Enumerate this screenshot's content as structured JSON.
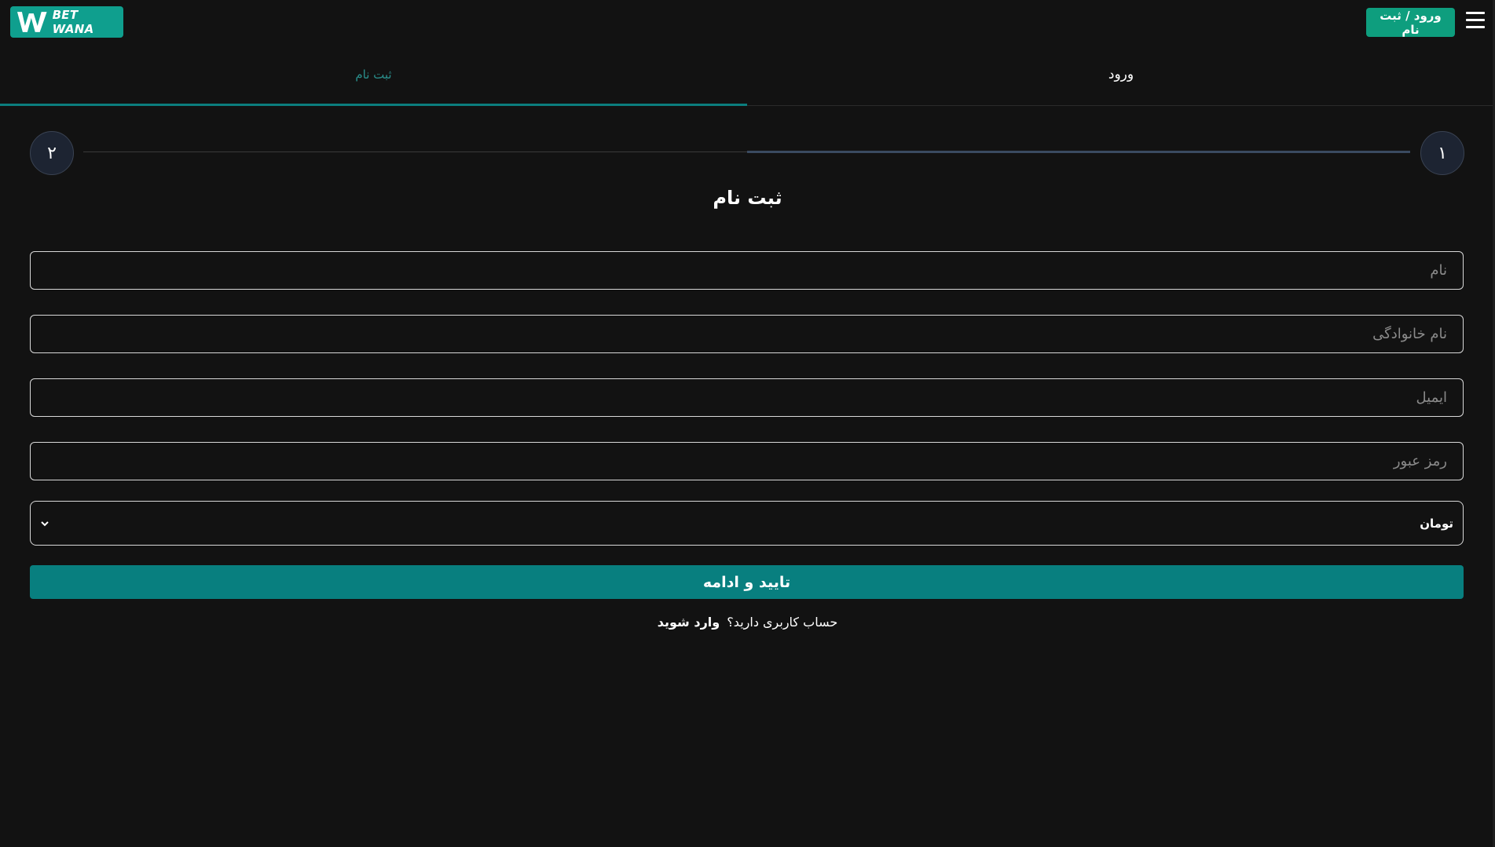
{
  "header": {
    "brand": "BET WANA",
    "auth_button": "ورود / ثبت نام",
    "menu_icon": "hamburger-icon"
  },
  "tabs": [
    {
      "label": "ثبت نام",
      "active": true
    },
    {
      "label": "ورود",
      "active": false
    }
  ],
  "stepper": {
    "step1": "۱",
    "step2": "۲",
    "current": 1
  },
  "form": {
    "title": "ثبت نام",
    "first_name_placeholder": "نام",
    "last_name_placeholder": "نام خانوادگی",
    "email_placeholder": "ایمیل",
    "password_placeholder": "رمز عبور",
    "currency": "تومان",
    "submit_label": "تایید و ادامه",
    "have_account_text": "حساب کاربری دارید؟",
    "login_link": "وارد شوید"
  },
  "colors": {
    "background": "#121212",
    "brand": "#0f9f8e",
    "auth_button": "#0e9e7e",
    "submit": "#087f7f",
    "active_tab": "#2a8f8c"
  }
}
